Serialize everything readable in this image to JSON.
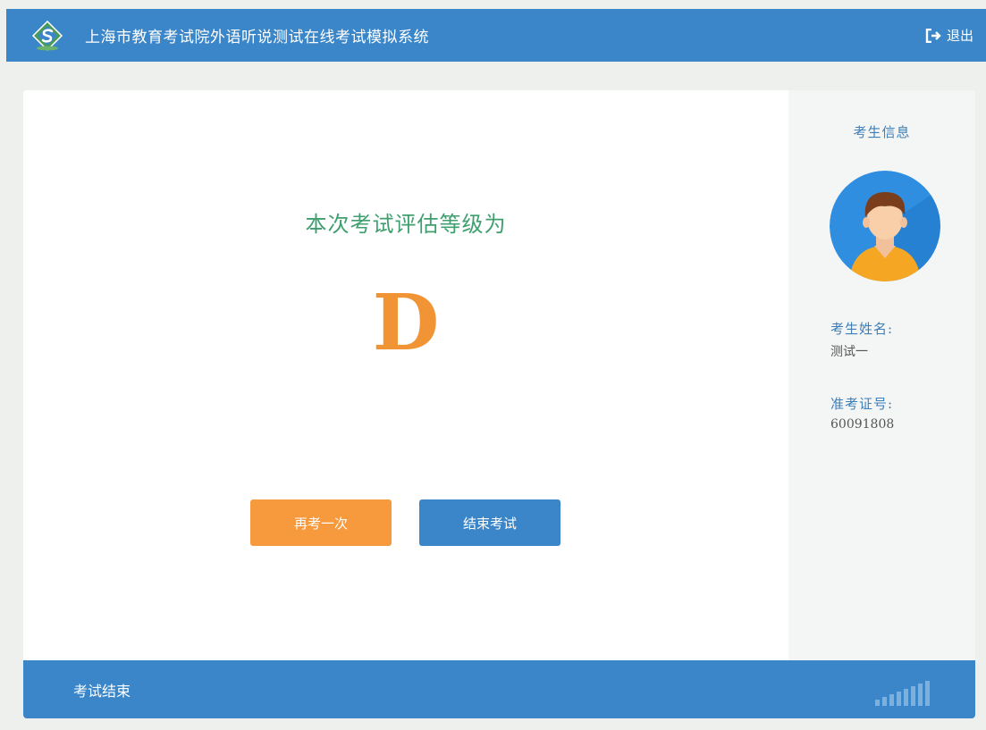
{
  "header": {
    "title": "上海市教育考试院外语听说测试在线考试模拟系统",
    "logout_label": "退出",
    "logo_icon": "exam-logo-icon",
    "logout_icon": "logout-icon"
  },
  "result": {
    "label": "本次考试评估等级为",
    "grade": "D"
  },
  "actions": {
    "retry_label": "再考一次",
    "end_label": "结束考试"
  },
  "sidebar": {
    "title": "考生信息",
    "avatar_icon": "student-avatar",
    "name_label": "考生姓名:",
    "name_value": "测试一",
    "id_label": "准考证号:",
    "id_value": "60091808"
  },
  "footer": {
    "status": "考试结束",
    "signal_icon": "signal-strength-icon"
  },
  "colors": {
    "primary": "#3a86c8",
    "accent_orange": "#f7993d",
    "grade_orange": "#f19435",
    "label_green": "#3f9f6e",
    "sidebar_text_blue": "#3d7fb8"
  }
}
